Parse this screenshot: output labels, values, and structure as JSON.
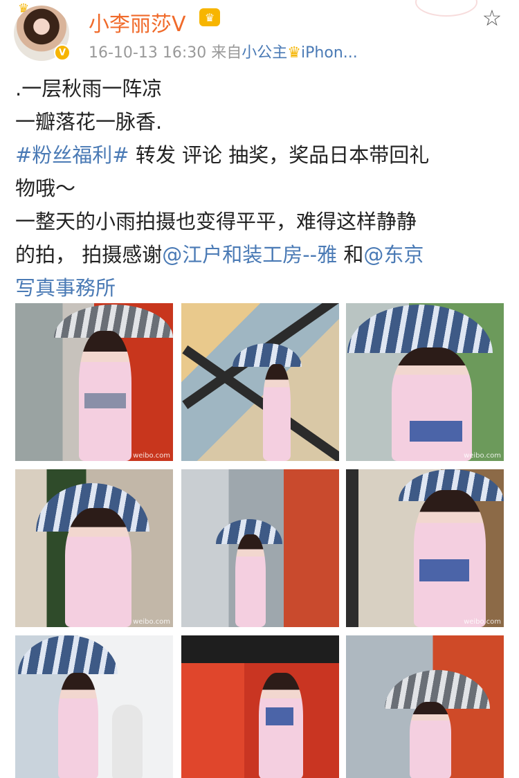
{
  "post": {
    "username": "小李丽莎V",
    "vip_badge": "♛",
    "verified_mark": "V",
    "timestamp": "16-10-13 16:30",
    "source_prefix": "来自",
    "source_app": "小公主",
    "source_device": "iPhon...",
    "star_icon": "☆"
  },
  "content": {
    "line1": ".一层秋雨一阵凉",
    "line2": "一瓣落花一脉香.",
    "hashtag": "#粉丝福利#",
    "line3_rest": " 转发 评论 抽奖，奖品日本带回礼",
    "line4": "物哦～",
    "line5": "一整天的小雨拍摄也变得平平，难得这样静静",
    "line6_prefix": "的拍，  拍摄感谢",
    "mention1": "@江户和装工房--雅",
    "line6_mid": " 和",
    "mention2_part1": "@东京",
    "mention2_part2": "写真事務所"
  },
  "photos": {
    "watermark": "weibo.com",
    "items": [
      {
        "id": "photo-1",
        "scene": "umbrella-street-red-door"
      },
      {
        "id": "photo-2",
        "scene": "glass-building-crossbars"
      },
      {
        "id": "photo-3",
        "scene": "back-view-blue-obi-umbrella"
      },
      {
        "id": "photo-4",
        "scene": "storefront-umbrella"
      },
      {
        "id": "photo-5",
        "scene": "alley-walk"
      },
      {
        "id": "photo-6",
        "scene": "shop-sign-back-view"
      },
      {
        "id": "photo-7",
        "scene": "umbrella-statue"
      },
      {
        "id": "photo-8",
        "scene": "red-wall-lanterns"
      },
      {
        "id": "photo-9",
        "scene": "street-umbrella-red-gate"
      }
    ]
  },
  "colors": {
    "username": "#f06a2a",
    "link": "#4a7ab5",
    "meta_gray": "#999999",
    "vip_gold": "#f7b500"
  }
}
